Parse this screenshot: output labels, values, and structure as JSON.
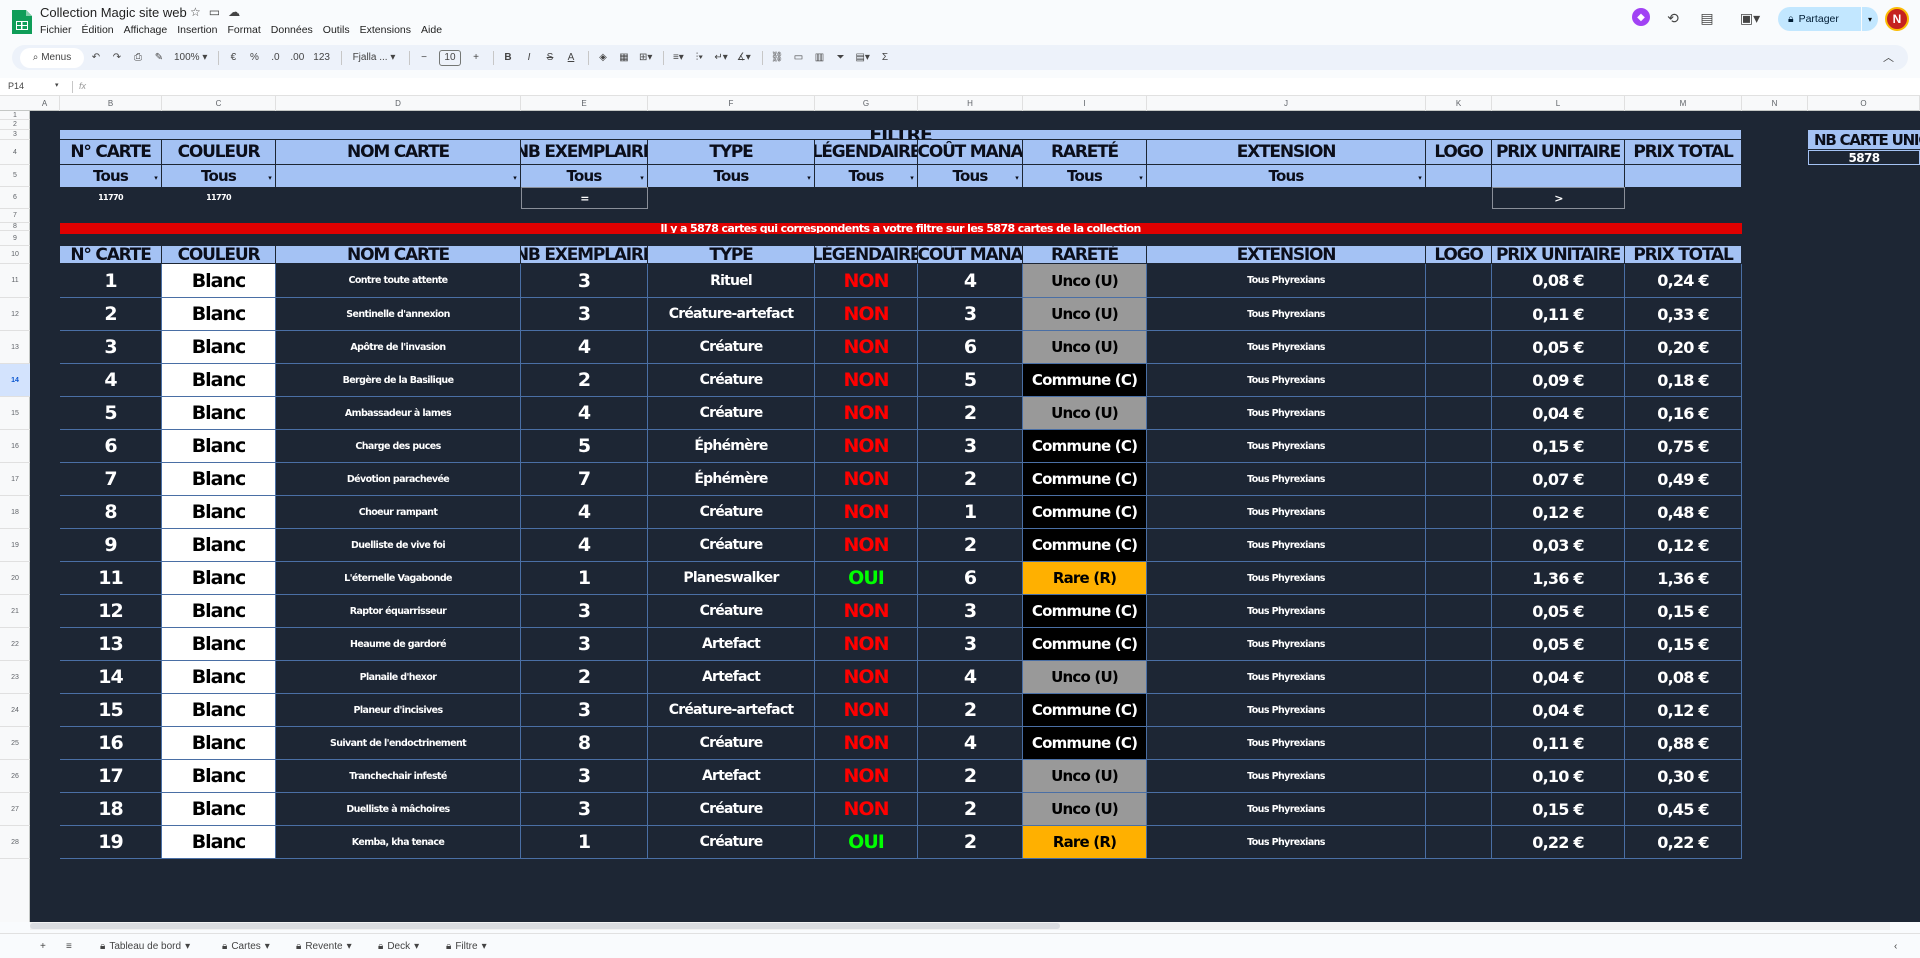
{
  "app": {
    "title": "Collection Magic site web",
    "menu": [
      "Fichier",
      "Édition",
      "Affichage",
      "Insertion",
      "Format",
      "Données",
      "Outils",
      "Extensions",
      "Aide"
    ],
    "share_label": "Partager",
    "avatar_letter": "N"
  },
  "toolbar": {
    "menus_label": "Menus",
    "zoom": "100%",
    "currency": "€",
    "percent": "%",
    "dec_less": ".0",
    "dec_more": ".00",
    "format_123": "123",
    "font": "Fjalla ...",
    "font_size": "10",
    "bold": "B",
    "italic": "I",
    "strike": "S",
    "text_color": "A",
    "sigma": "Σ"
  },
  "formula": {
    "cell_ref": "P14",
    "fx": "fx"
  },
  "columns": [
    "A",
    "B",
    "C",
    "D",
    "E",
    "F",
    "G",
    "H",
    "I",
    "J",
    "K",
    "L",
    "M",
    "N",
    "O"
  ],
  "rows": [
    "1",
    "2",
    "3",
    "4",
    "5",
    "6",
    "7",
    "8",
    "9",
    "10",
    "11",
    "12",
    "13",
    "14",
    "15",
    "16",
    "17",
    "18",
    "19",
    "20",
    "21",
    "22",
    "23",
    "24",
    "25",
    "26",
    "27",
    "28"
  ],
  "selected_row": "14",
  "filter_panel": {
    "title": "FILTRE",
    "headers": [
      "N° CARTE",
      "COULEUR",
      "NOM CARTE",
      "NB EXEMPLAIRE",
      "TYPE",
      "LÉGENDAIRE",
      "COÛT MANA",
      "RARETÉ",
      "EXTENSION",
      "LOGO",
      "PRIX UNITAIRE",
      "PRIX TOTAL"
    ],
    "values": [
      "Tous",
      "Tous",
      "",
      "Tous",
      "Tous",
      "Tous",
      "Tous",
      "Tous",
      "Tous",
      "",
      "",
      ""
    ],
    "row6_b": "11770",
    "row6_c": "11770",
    "row6_e": "=",
    "row6_l": ">",
    "message": "Il y a 5878 cartes qui correspondents a votre filtre sur les 5878 cartes de la collection"
  },
  "unique_panel": {
    "header": "NB CARTE UNIQ",
    "value": "5878"
  },
  "table": {
    "headers": [
      "N° CARTE",
      "COULEUR",
      "NOM CARTE",
      "NB EXEMPLAIRE",
      "TYPE",
      "LÉGENDAIRE",
      "COÛT MANA",
      "RARETÉ",
      "EXTENSION",
      "LOGO",
      "PRIX UNITAIRE",
      "PRIX TOTAL"
    ],
    "rows": [
      {
        "num": "1",
        "color": "Blanc",
        "name": "Contre toute attente",
        "qty": "3",
        "type": "Rituel",
        "leg": "NON",
        "mana": "4",
        "rarity": "Unco (U)",
        "rk": "unco",
        "ext": "Tous Phyrexians",
        "unit": "0,08 €",
        "total": "0,24 €"
      },
      {
        "num": "2",
        "color": "Blanc",
        "name": "Sentinelle d'annexion",
        "qty": "3",
        "type": "Créature-artefact",
        "leg": "NON",
        "mana": "3",
        "rarity": "Unco (U)",
        "rk": "unco",
        "ext": "Tous Phyrexians",
        "unit": "0,11 €",
        "total": "0,33 €"
      },
      {
        "num": "3",
        "color": "Blanc",
        "name": "Apôtre de l'invasion",
        "qty": "4",
        "type": "Créature",
        "leg": "NON",
        "mana": "6",
        "rarity": "Unco (U)",
        "rk": "unco",
        "ext": "Tous Phyrexians",
        "unit": "0,05 €",
        "total": "0,20 €"
      },
      {
        "num": "4",
        "color": "Blanc",
        "name": "Bergère de la Basilique",
        "qty": "2",
        "type": "Créature",
        "leg": "NON",
        "mana": "5",
        "rarity": "Commune (C)",
        "rk": "com",
        "ext": "Tous Phyrexians",
        "unit": "0,09 €",
        "total": "0,18 €"
      },
      {
        "num": "5",
        "color": "Blanc",
        "name": "Ambassadeur à lames",
        "qty": "4",
        "type": "Créature",
        "leg": "NON",
        "mana": "2",
        "rarity": "Unco (U)",
        "rk": "unco",
        "ext": "Tous Phyrexians",
        "unit": "0,04 €",
        "total": "0,16 €"
      },
      {
        "num": "6",
        "color": "Blanc",
        "name": "Charge des puces",
        "qty": "5",
        "type": "Éphémère",
        "leg": "NON",
        "mana": "3",
        "rarity": "Commune (C)",
        "rk": "com",
        "ext": "Tous Phyrexians",
        "unit": "0,15 €",
        "total": "0,75 €"
      },
      {
        "num": "7",
        "color": "Blanc",
        "name": "Dévotion parachevée",
        "qty": "7",
        "type": "Éphémère",
        "leg": "NON",
        "mana": "2",
        "rarity": "Commune (C)",
        "rk": "com",
        "ext": "Tous Phyrexians",
        "unit": "0,07 €",
        "total": "0,49 €"
      },
      {
        "num": "8",
        "color": "Blanc",
        "name": "Choeur rampant",
        "qty": "4",
        "type": "Créature",
        "leg": "NON",
        "mana": "1",
        "rarity": "Commune (C)",
        "rk": "com",
        "ext": "Tous Phyrexians",
        "unit": "0,12 €",
        "total": "0,48 €"
      },
      {
        "num": "9",
        "color": "Blanc",
        "name": "Duelliste de vive foi",
        "qty": "4",
        "type": "Créature",
        "leg": "NON",
        "mana": "2",
        "rarity": "Commune (C)",
        "rk": "com",
        "ext": "Tous Phyrexians",
        "unit": "0,03 €",
        "total": "0,12 €"
      },
      {
        "num": "11",
        "color": "Blanc",
        "name": "L'éternelle Vagabonde",
        "qty": "1",
        "type": "Planeswalker",
        "leg": "OUI",
        "mana": "6",
        "rarity": "Rare (R)",
        "rk": "rare",
        "ext": "Tous Phyrexians",
        "unit": "1,36 €",
        "total": "1,36 €"
      },
      {
        "num": "12",
        "color": "Blanc",
        "name": "Raptor équarrisseur",
        "qty": "3",
        "type": "Créature",
        "leg": "NON",
        "mana": "3",
        "rarity": "Commune (C)",
        "rk": "com",
        "ext": "Tous Phyrexians",
        "unit": "0,05 €",
        "total": "0,15 €"
      },
      {
        "num": "13",
        "color": "Blanc",
        "name": "Heaume de gardoré",
        "qty": "3",
        "type": "Artefact",
        "leg": "NON",
        "mana": "3",
        "rarity": "Commune (C)",
        "rk": "com",
        "ext": "Tous Phyrexians",
        "unit": "0,05 €",
        "total": "0,15 €"
      },
      {
        "num": "14",
        "color": "Blanc",
        "name": "Planaile d'hexor",
        "qty": "2",
        "type": "Artefact",
        "leg": "NON",
        "mana": "4",
        "rarity": "Unco (U)",
        "rk": "unco",
        "ext": "Tous Phyrexians",
        "unit": "0,04 €",
        "total": "0,08 €"
      },
      {
        "num": "15",
        "color": "Blanc",
        "name": "Planeur d'incisives",
        "qty": "3",
        "type": "Créature-artefact",
        "leg": "NON",
        "mana": "2",
        "rarity": "Commune (C)",
        "rk": "com",
        "ext": "Tous Phyrexians",
        "unit": "0,04 €",
        "total": "0,12 €"
      },
      {
        "num": "16",
        "color": "Blanc",
        "name": "Suivant de l'endoctrinement",
        "qty": "8",
        "type": "Créature",
        "leg": "NON",
        "mana": "4",
        "rarity": "Commune (C)",
        "rk": "com",
        "ext": "Tous Phyrexians",
        "unit": "0,11 €",
        "total": "0,88 €"
      },
      {
        "num": "17",
        "color": "Blanc",
        "name": "Tranchechair infesté",
        "qty": "3",
        "type": "Artefact",
        "leg": "NON",
        "mana": "2",
        "rarity": "Unco (U)",
        "rk": "unco",
        "ext": "Tous Phyrexians",
        "unit": "0,10 €",
        "total": "0,30 €"
      },
      {
        "num": "18",
        "color": "Blanc",
        "name": "Duelliste à mâchoires",
        "qty": "3",
        "type": "Créature",
        "leg": "NON",
        "mana": "2",
        "rarity": "Unco (U)",
        "rk": "unco",
        "ext": "Tous Phyrexians",
        "unit": "0,15 €",
        "total": "0,45 €"
      },
      {
        "num": "19",
        "color": "Blanc",
        "name": "Kemba, kha tenace",
        "qty": "1",
        "type": "Créature",
        "leg": "OUI",
        "mana": "2",
        "rarity": "Rare (R)",
        "rk": "rare",
        "ext": "Tous Phyrexians",
        "unit": "0,22 €",
        "total": "0,22 €"
      }
    ]
  },
  "sheets": [
    {
      "label": "Tableau de bord",
      "active": true
    },
    {
      "label": "Cartes",
      "active": false
    },
    {
      "label": "Revente",
      "active": false
    },
    {
      "label": "Deck",
      "active": false
    },
    {
      "label": "Filtre",
      "active": false
    }
  ],
  "colors": {
    "background": "#1d2634",
    "header_blue": "#a4c2f4",
    "banner_red": "#e00000",
    "non_red": "#ff0000",
    "oui_green": "#00ff00",
    "unco_grey": "#999999",
    "common_black": "#000000",
    "rare_orange": "#ffb000"
  }
}
